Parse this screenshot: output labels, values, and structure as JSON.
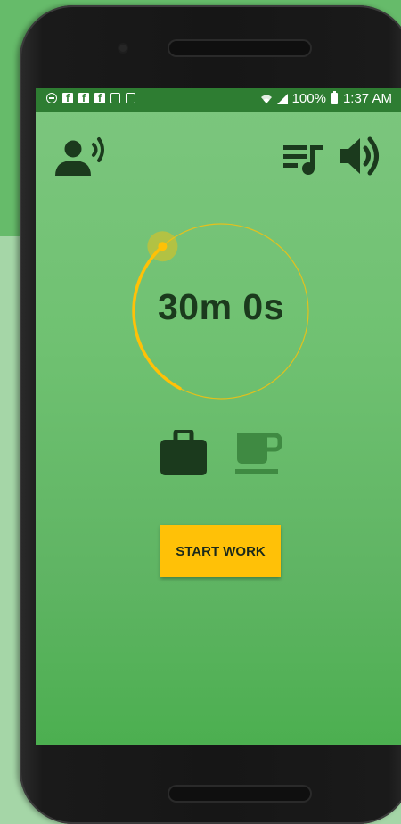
{
  "status_bar": {
    "battery": "100%",
    "time": "1:37 AM"
  },
  "toolbar": {
    "voice_icon": "person-speaking-icon",
    "playlist_icon": "playlist-music-icon",
    "volume_icon": "volume-up-icon"
  },
  "timer": {
    "display": "30m 0s",
    "progress": 0.42
  },
  "modes": {
    "work_icon": "briefcase-icon",
    "break_icon": "coffee-cup-icon",
    "selected": "work"
  },
  "actions": {
    "start_label": "START WORK"
  },
  "colors": {
    "accent": "#ffc107",
    "primary_dark": "#2e7d32",
    "icon_dark": "#1b3a1d"
  }
}
